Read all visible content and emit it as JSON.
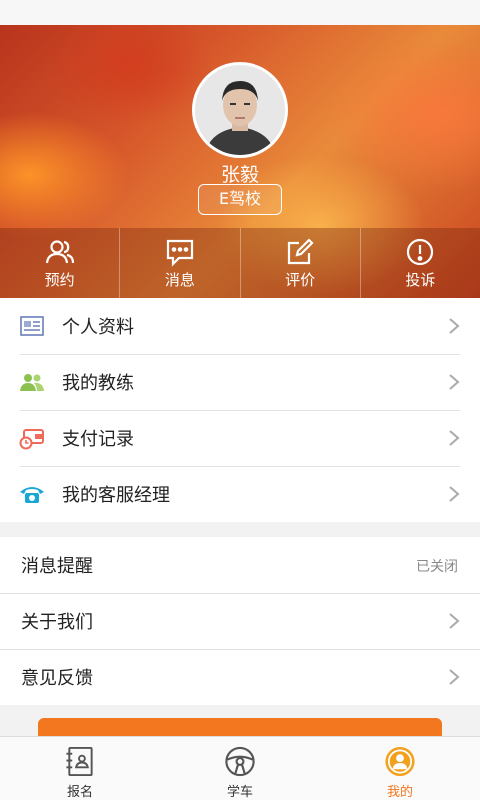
{
  "profile": {
    "name": "张毅",
    "school": "E驾校"
  },
  "actions": [
    {
      "label": "预约",
      "icon": "people-icon"
    },
    {
      "label": "消息",
      "icon": "message-icon"
    },
    {
      "label": "评价",
      "icon": "edit-icon"
    },
    {
      "label": "投诉",
      "icon": "alert-icon"
    }
  ],
  "menu_main": [
    {
      "label": "个人资料",
      "icon": "profile-card-icon",
      "color": "#6a7fb8"
    },
    {
      "label": "我的教练",
      "icon": "coach-icon",
      "color": "#8cc152"
    },
    {
      "label": "支付记录",
      "icon": "wallet-icon",
      "color": "#f06a5a"
    },
    {
      "label": "我的客服经理",
      "icon": "phone-icon",
      "color": "#1aa6d6"
    }
  ],
  "menu_settings": [
    {
      "label": "消息提醒",
      "status": "已关闭"
    },
    {
      "label": "关于我们"
    },
    {
      "label": "意见反馈"
    }
  ],
  "tabs": [
    {
      "label": "报名",
      "icon": "signup-icon"
    },
    {
      "label": "学车",
      "icon": "steering-wheel-icon"
    },
    {
      "label": "我的",
      "icon": "user-icon",
      "active": true
    }
  ],
  "colors": {
    "accent": "#f2771f"
  }
}
